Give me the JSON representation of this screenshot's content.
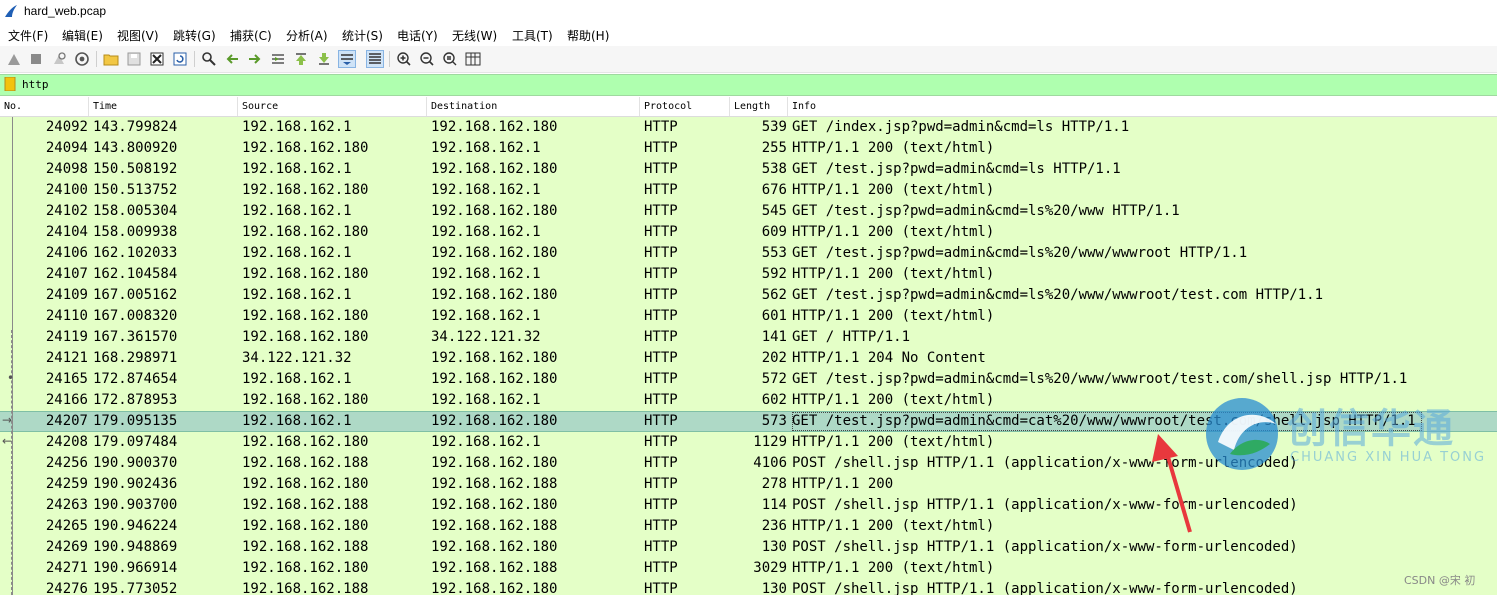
{
  "window": {
    "title": "hard_web.pcap"
  },
  "menu": [
    "文件(F)",
    "编辑(E)",
    "视图(V)",
    "跳转(G)",
    "捕获(C)",
    "分析(A)",
    "统计(S)",
    "电话(Y)",
    "无线(W)",
    "工具(T)",
    "帮助(H)"
  ],
  "filter": {
    "value": "http"
  },
  "columns": [
    "No.",
    "Time",
    "Source",
    "Destination",
    "Protocol",
    "Length",
    "Info"
  ],
  "packets": [
    {
      "no": "24092",
      "time": "143.799824",
      "src": "192.168.162.1",
      "dst": "192.168.162.180",
      "proto": "HTTP",
      "len": "539",
      "info": "GET /index.jsp?pwd=admin&cmd=ls HTTP/1.1"
    },
    {
      "no": "24094",
      "time": "143.800920",
      "src": "192.168.162.180",
      "dst": "192.168.162.1",
      "proto": "HTTP",
      "len": "255",
      "info": "HTTP/1.1 200   (text/html)"
    },
    {
      "no": "24098",
      "time": "150.508192",
      "src": "192.168.162.1",
      "dst": "192.168.162.180",
      "proto": "HTTP",
      "len": "538",
      "info": "GET /test.jsp?pwd=admin&cmd=ls HTTP/1.1"
    },
    {
      "no": "24100",
      "time": "150.513752",
      "src": "192.168.162.180",
      "dst": "192.168.162.1",
      "proto": "HTTP",
      "len": "676",
      "info": "HTTP/1.1 200   (text/html)"
    },
    {
      "no": "24102",
      "time": "158.005304",
      "src": "192.168.162.1",
      "dst": "192.168.162.180",
      "proto": "HTTP",
      "len": "545",
      "info": "GET /test.jsp?pwd=admin&cmd=ls%20/www HTTP/1.1"
    },
    {
      "no": "24104",
      "time": "158.009938",
      "src": "192.168.162.180",
      "dst": "192.168.162.1",
      "proto": "HTTP",
      "len": "609",
      "info": "HTTP/1.1 200   (text/html)"
    },
    {
      "no": "24106",
      "time": "162.102033",
      "src": "192.168.162.1",
      "dst": "192.168.162.180",
      "proto": "HTTP",
      "len": "553",
      "info": "GET /test.jsp?pwd=admin&cmd=ls%20/www/wwwroot HTTP/1.1"
    },
    {
      "no": "24107",
      "time": "162.104584",
      "src": "192.168.162.180",
      "dst": "192.168.162.1",
      "proto": "HTTP",
      "len": "592",
      "info": "HTTP/1.1 200   (text/html)"
    },
    {
      "no": "24109",
      "time": "167.005162",
      "src": "192.168.162.1",
      "dst": "192.168.162.180",
      "proto": "HTTP",
      "len": "562",
      "info": "GET /test.jsp?pwd=admin&cmd=ls%20/www/wwwroot/test.com HTTP/1.1"
    },
    {
      "no": "24110",
      "time": "167.008320",
      "src": "192.168.162.180",
      "dst": "192.168.162.1",
      "proto": "HTTP",
      "len": "601",
      "info": "HTTP/1.1 200   (text/html)"
    },
    {
      "no": "24119",
      "time": "167.361570",
      "src": "192.168.162.180",
      "dst": "34.122.121.32",
      "proto": "HTTP",
      "len": "141",
      "info": "GET / HTTP/1.1"
    },
    {
      "no": "24121",
      "time": "168.298971",
      "src": "34.122.121.32",
      "dst": "192.168.162.180",
      "proto": "HTTP",
      "len": "202",
      "info": "HTTP/1.1 204 No Content"
    },
    {
      "no": "24165",
      "time": "172.874654",
      "src": "192.168.162.1",
      "dst": "192.168.162.180",
      "proto": "HTTP",
      "len": "572",
      "info": "GET /test.jsp?pwd=admin&cmd=ls%20/www/wwwroot/test.com/shell.jsp HTTP/1.1"
    },
    {
      "no": "24166",
      "time": "172.878953",
      "src": "192.168.162.180",
      "dst": "192.168.162.1",
      "proto": "HTTP",
      "len": "602",
      "info": "HTTP/1.1 200   (text/html)"
    },
    {
      "no": "24207",
      "time": "179.095135",
      "src": "192.168.162.1",
      "dst": "192.168.162.180",
      "proto": "HTTP",
      "len": "573",
      "info": "GET /test.jsp?pwd=admin&cmd=cat%20/www/wwwroot/test.com/shell.jsp HTTP/1.1",
      "selected": true
    },
    {
      "no": "24208",
      "time": "179.097484",
      "src": "192.168.162.180",
      "dst": "192.168.162.1",
      "proto": "HTTP",
      "len": "1129",
      "info": "HTTP/1.1 200   (text/html)"
    },
    {
      "no": "24256",
      "time": "190.900370",
      "src": "192.168.162.188",
      "dst": "192.168.162.180",
      "proto": "HTTP",
      "len": "4106",
      "info": "POST /shell.jsp HTTP/1.1  (application/x-www-form-urlencoded)"
    },
    {
      "no": "24259",
      "time": "190.902436",
      "src": "192.168.162.180",
      "dst": "192.168.162.188",
      "proto": "HTTP",
      "len": "278",
      "info": "HTTP/1.1 200"
    },
    {
      "no": "24263",
      "time": "190.903700",
      "src": "192.168.162.188",
      "dst": "192.168.162.180",
      "proto": "HTTP",
      "len": "114",
      "info": "POST /shell.jsp HTTP/1.1  (application/x-www-form-urlencoded)"
    },
    {
      "no": "24265",
      "time": "190.946224",
      "src": "192.168.162.180",
      "dst": "192.168.162.188",
      "proto": "HTTP",
      "len": "236",
      "info": "HTTP/1.1 200   (text/html)"
    },
    {
      "no": "24269",
      "time": "190.948869",
      "src": "192.168.162.188",
      "dst": "192.168.162.180",
      "proto": "HTTP",
      "len": "130",
      "info": "POST /shell.jsp HTTP/1.1  (application/x-www-form-urlencoded)"
    },
    {
      "no": "24271",
      "time": "190.966914",
      "src": "192.168.162.180",
      "dst": "192.168.162.188",
      "proto": "HTTP",
      "len": "3029",
      "info": "HTTP/1.1 200   (text/html)"
    },
    {
      "no": "24276",
      "time": "195.773052",
      "src": "192.168.162.188",
      "dst": "192.168.162.180",
      "proto": "HTTP",
      "len": "130",
      "info": "POST /shell.jsp HTTP/1.1  (application/x-www-form-urlencoded)"
    }
  ],
  "watermark": {
    "brand": "创信华通",
    "sub": "CHUANG XIN HUA TONG",
    "credit": "CSDN @宋 初"
  },
  "colors": {
    "row_bg": "#e4ffc7",
    "selected_bg": "#aed9c6",
    "filter_bg": "#afffaf",
    "arrow": "#e8383d"
  }
}
